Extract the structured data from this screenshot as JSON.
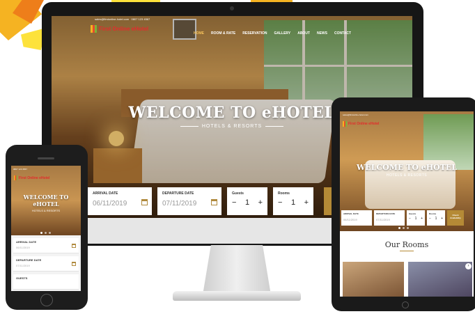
{
  "site": {
    "logo_text": "First Online eHotel",
    "topbar_email": "sales@firstonline-hotel.com",
    "topbar_phone": "0807 123 4567"
  },
  "nav": [
    "HOME",
    "ROOM & RATE",
    "RESERVATION",
    "GALLERY",
    "ABOUT",
    "NEWS",
    "CONTACT"
  ],
  "hero": {
    "title": "WELCOME TO eHOTEL",
    "subtitle": "HOTELS & RESORTS"
  },
  "booking": {
    "arrival_label": "ARRIVAL DATE",
    "arrival_value": "06/11/2019",
    "departure_label": "DEPARTURE DATE",
    "departure_value": "07/11/2019",
    "guests_label": "Guests",
    "guests_value": "1",
    "rooms_label": "Rooms",
    "rooms_value": "1",
    "minus": "−",
    "plus": "+",
    "check_label": "Check Availability"
  },
  "tablet": {
    "logo_text": "First Online eHotel",
    "title": "WELCOME TO eHOTEL",
    "subtitle": "HOTELS & RESORTS",
    "our_rooms": "Our Rooms",
    "arrow": "›"
  },
  "phone": {
    "logo_text": "First Online eHotel",
    "title_line1": "WELCOME TO",
    "title_line2": "eHOTEL",
    "subtitle": "HOTELS & RESORTS",
    "guests_label": "GUESTS"
  },
  "colors": {
    "accent": "#b58a36",
    "logo_red": "#e22c2c",
    "active_nav": "#f5c25a"
  }
}
